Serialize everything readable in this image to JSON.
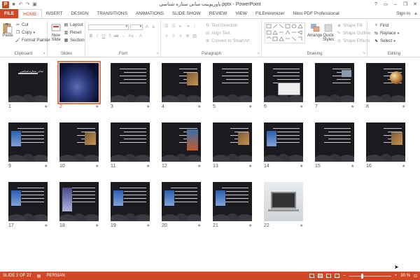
{
  "titlebar": {
    "logo": "P",
    "title": "پاورپوینت مبانی ستاره شناسی.pptx - PowerPoint",
    "qat": [
      "save-icon",
      "undo-icon",
      "redo-icon",
      "start-slideshow-icon"
    ],
    "window_controls": [
      "?",
      "▭",
      "–",
      "❐",
      "✕"
    ]
  },
  "tabs": {
    "items": [
      "FILE",
      "HOME",
      "INSERT",
      "DESIGN",
      "TRANSITIONS",
      "ANIMATIONS",
      "SLIDE SHOW",
      "REVIEW",
      "VIEW",
      "FILEminimizer",
      "Nitro PDF Professional"
    ],
    "active": "HOME",
    "signin": "Sign in"
  },
  "ribbon": {
    "clipboard": {
      "label": "Clipboard",
      "paste": "Paste",
      "cut": "Cut",
      "copy": "Copy",
      "format_painter": "Format Painter"
    },
    "slides": {
      "label": "Slides",
      "new_slide": "New",
      "new_slide2": "Slide",
      "layout": "Layout",
      "reset": "Reset",
      "section": "Section"
    },
    "font": {
      "label": "Font",
      "font_name": "",
      "font_size": ""
    },
    "paragraph": {
      "label": "Paragraph",
      "text_direction": "Text Direction",
      "align_text": "Align Text",
      "convert_smartart": "Convert to SmartArt"
    },
    "drawing": {
      "label": "Drawing",
      "arrange": "Arrange",
      "quick_styles": "Quick",
      "quick_styles2": "Styles",
      "shape_fill": "Shape Fill",
      "shape_outline": "Shape Outline",
      "shape_effects": "Shape Effects"
    },
    "editing": {
      "label": "Editing",
      "find": "Find",
      "replace": "Replace",
      "select": "Select"
    }
  },
  "slides": [
    {
      "num": "1"
    },
    {
      "num": "2"
    },
    {
      "num": "3"
    },
    {
      "num": "4"
    },
    {
      "num": "5"
    },
    {
      "num": "6"
    },
    {
      "num": "7"
    },
    {
      "num": "8"
    },
    {
      "num": "9"
    },
    {
      "num": "10"
    },
    {
      "num": "11"
    },
    {
      "num": "12"
    },
    {
      "num": "13"
    },
    {
      "num": "14"
    },
    {
      "num": "15"
    },
    {
      "num": "16"
    },
    {
      "num": "17"
    },
    {
      "num": "18"
    },
    {
      "num": "19"
    },
    {
      "num": "20"
    },
    {
      "num": "21"
    },
    {
      "num": "22"
    }
  ],
  "selected_slide": 2,
  "slide_titles": {
    "s1": "مبانی ستاره شناسی"
  },
  "statusbar": {
    "slide_indicator": "SLIDE 2 OF 22",
    "language": "PERSIAN",
    "zoom": "30 %",
    "zoom_fraction": 0.3
  },
  "colors": {
    "accent": "#d24726",
    "selected_outline": "#e07a52",
    "slide_bg": "#1a1a1f"
  }
}
